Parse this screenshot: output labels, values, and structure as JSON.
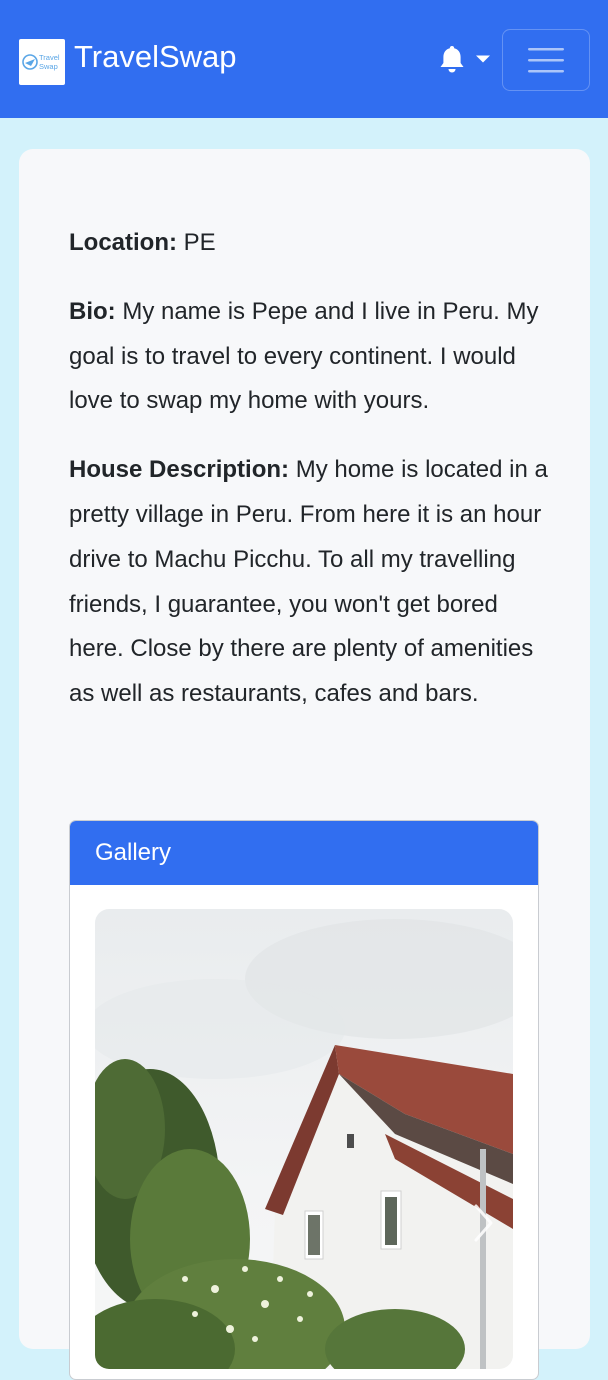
{
  "navbar": {
    "logo_text": "TravelSwap",
    "logo_lines": [
      "Travel",
      "Swap"
    ],
    "brand": "TravelSwap",
    "notifications_icon": "bell-icon",
    "dropdown_icon": "caret-down-icon",
    "menu_icon": "hamburger-icon"
  },
  "profile": {
    "location_label": "Location:",
    "location_value": "PE",
    "bio_label": "Bio:",
    "bio_value": "My name is Pepe and I live in Peru. My goal is to travel to every continent. I would love to swap my home with yours.",
    "house_label": "House Description:",
    "house_value": "My home is located in a pretty village in Peru. From here it is an hour drive to Machu Picchu. To all my travelling friends, I guarantee, you won't get bored here. Close by there are plenty of amenities as well as restaurants, cafes and bars."
  },
  "gallery": {
    "title": "Gallery",
    "next_icon": "chevron-right-icon"
  },
  "colors": {
    "primary": "#316ef0",
    "page_bg": "#d3f2fb",
    "card_bg": "#f7f8fa"
  }
}
